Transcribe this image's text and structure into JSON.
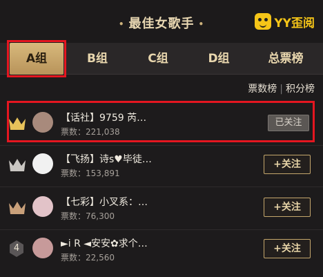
{
  "header": {
    "title": "最佳女歌手",
    "title_dots": "•",
    "brand": "YY歪阅"
  },
  "tabs": [
    {
      "label": "A组",
      "active": true
    },
    {
      "label": "B组",
      "active": false
    },
    {
      "label": "C组",
      "active": false
    },
    {
      "label": "D组",
      "active": false
    },
    {
      "label": "总票榜",
      "active": false
    }
  ],
  "subnav": {
    "votes_rank": "票数榜",
    "separator": "|",
    "points_rank": "积分榜"
  },
  "rows": [
    {
      "rank": "1",
      "rank_style": "gold-crown",
      "name": "【话社】9759 芮…",
      "votes": "票数：221,038",
      "button": "已关注",
      "followed": true
    },
    {
      "rank": "2",
      "rank_style": "silver-crown",
      "name": "【飞扬】诗s♥毕徒…",
      "votes": "票数：153,891",
      "button": "+关注",
      "followed": false
    },
    {
      "rank": "3",
      "rank_style": "bronze-crown",
      "name": "【七彩】小叉系：…",
      "votes": "票数：76,300",
      "button": "+关注",
      "followed": false
    },
    {
      "rank": "4",
      "rank_style": "number",
      "name": "►i R ◄安安✿求个…",
      "votes": "票数：22,560",
      "button": "+关注",
      "followed": false
    }
  ],
  "colors": {
    "accent_gold": "#d8b97c",
    "highlight_red": "#e51620",
    "background": "#1d1b1c"
  }
}
